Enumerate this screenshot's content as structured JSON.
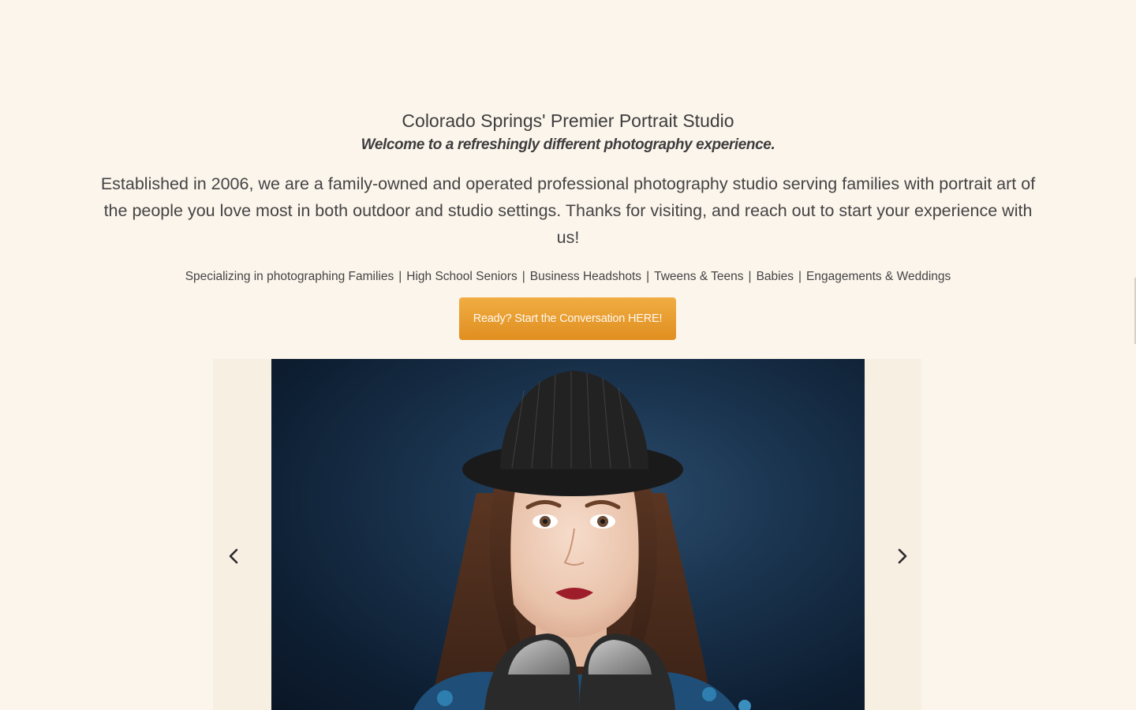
{
  "intro": {
    "headline": "Colorado Springs' Premier Portrait Studio",
    "tagline": "Welcome to a refreshingly different photography experience.",
    "about": "Established in 2006, we are a family-owned and operated professional photography studio serving families with portrait art of the people you love most in both outdoor and studio settings. Thanks for visiting, and reach out to start your experience with us!",
    "specialties_prefix": "Specializing in photographing Families",
    "specialties": [
      "High School Seniors",
      "Business Headshots",
      "Tweens & Teens",
      "Babies",
      "Engagements & Weddings"
    ],
    "separator": "|"
  },
  "cta": {
    "label": "Ready? Start the Conversation HERE!",
    "color_top": "#f0ad43",
    "color_bottom": "#e08e1f"
  },
  "slider": {
    "prev_icon": "chevron-left-icon",
    "next_icon": "chevron-right-icon",
    "current_slide": "portrait-photo"
  },
  "colors": {
    "background": "#fcf5ec",
    "text": "#3d3d3d",
    "accent": "#e8a030"
  }
}
